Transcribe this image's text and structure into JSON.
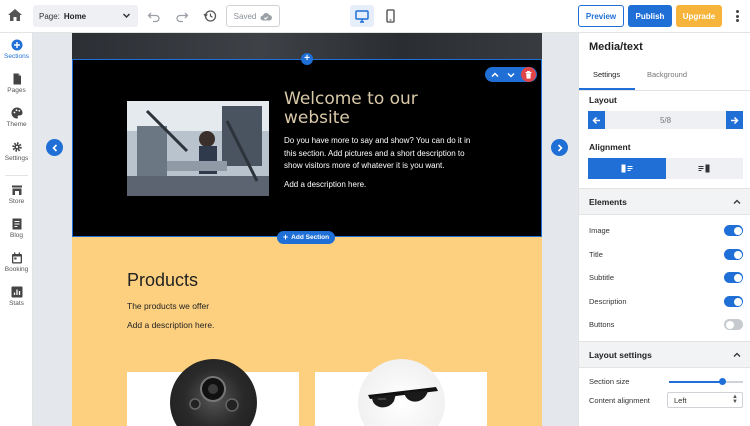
{
  "topbar": {
    "page_label": "Page:",
    "page_value": "Home",
    "saved_label": "Saved",
    "preview_label": "Preview",
    "publish_label": "Publish",
    "upgrade_label": "Upgrade"
  },
  "sidebar": {
    "items": [
      {
        "label": "Sections",
        "icon": "plus-circle-icon"
      },
      {
        "label": "Pages",
        "icon": "page-icon"
      },
      {
        "label": "Theme",
        "icon": "palette-icon"
      },
      {
        "label": "Settings",
        "icon": "gear-icon"
      },
      {
        "label": "Store",
        "icon": "store-icon"
      },
      {
        "label": "Blog",
        "icon": "blog-icon"
      },
      {
        "label": "Booking",
        "icon": "calendar-icon"
      },
      {
        "label": "Stats",
        "icon": "stats-icon"
      }
    ]
  },
  "canvas": {
    "hero": {
      "title": "Welcome to our website",
      "text": "Do you have more to say and show? You can do it in this section. Add pictures and a short description to show visitors more of whatever it is you want.",
      "description": "Add a description here."
    },
    "add_section_label": "Add Section",
    "products": {
      "title": "Products",
      "subtitle": "The products we offer",
      "description": "Add a description here."
    }
  },
  "panel": {
    "title": "Media/text",
    "tabs": [
      "Settings",
      "Background"
    ],
    "layout_label": "Layout",
    "layout_value": "5/8",
    "alignment_label": "Alignment",
    "elements_header": "Elements",
    "elements": [
      {
        "label": "Image",
        "on": true
      },
      {
        "label": "Title",
        "on": true
      },
      {
        "label": "Subtitle",
        "on": true
      },
      {
        "label": "Description",
        "on": true
      },
      {
        "label": "Buttons",
        "on": false
      }
    ],
    "layout_settings_header": "Layout settings",
    "section_size_label": "Section size",
    "section_size_value": 0.72,
    "content_alignment_label": "Content alignment",
    "content_alignment_value": "Left"
  },
  "colors": {
    "accent": "#1f6fd6",
    "upgrade": "#f6b43b",
    "delete": "#e0454a",
    "hero_title": "#d9c9a8",
    "products_bg": "#fcd07f"
  }
}
